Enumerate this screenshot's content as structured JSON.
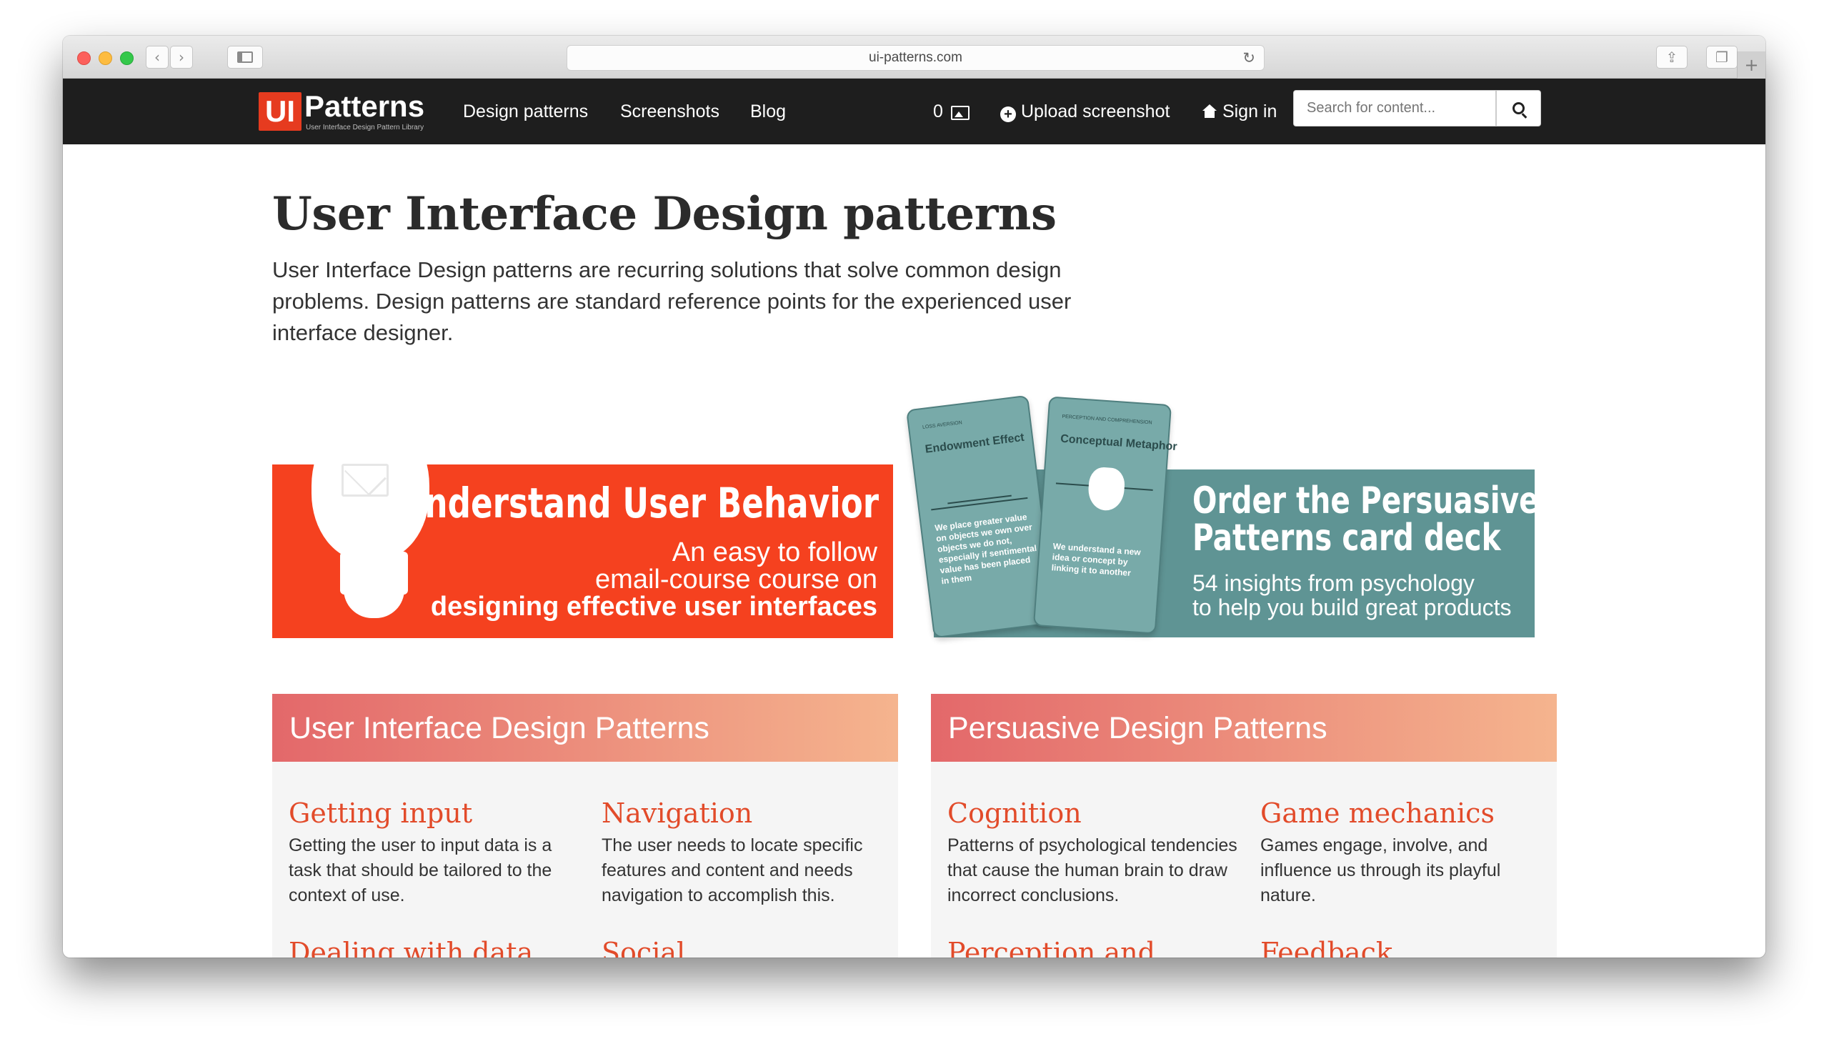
{
  "browser": {
    "url": "ui-patterns.com",
    "back_glyph": "‹",
    "forward_glyph": "›",
    "reload_glyph": "↻",
    "share_glyph": "⇪",
    "tabs_glyph": "❐",
    "new_tab_glyph": "+"
  },
  "nav": {
    "logo_ui": "UI",
    "logo_patterns": "Patterns",
    "logo_tagline": "User Interface Design Pattern Library",
    "links": [
      "Design patterns",
      "Screenshots",
      "Blog"
    ],
    "screenshot_count": "0",
    "upload_label": "Upload screenshot",
    "signin_label": "Sign in",
    "search_placeholder": "Search for content..."
  },
  "hero": {
    "title": "User Interface Design patterns",
    "intro": "User Interface Design patterns are recurring solutions that solve common design problems. Design patterns are standard reference points for the experienced user interface designer."
  },
  "banner_course": {
    "title": "Understand User Behavior",
    "line1": "An easy to follow",
    "line2": "email-course course on",
    "line3": "designing effective user interfaces",
    "color": "#f5411f"
  },
  "banner_cards": {
    "title_line1": "Order the Persuasive",
    "title_line2": "Patterns card deck",
    "sub_line1": "54 insights from psychology",
    "sub_line2": "to help you build great products",
    "color": "#5f9494",
    "card1": {
      "category": "LOSS AVERSION",
      "title": "Endowment Effect",
      "body": "We place greater value on objects we own over objects we do not, especially if sentimental value has been placed in them"
    },
    "card2": {
      "category": "PERCEPTION AND COMPREHENSION",
      "title": "Conceptual Metaphor",
      "body": "We understand a new idea or concept by linking it to another"
    }
  },
  "panels": [
    {
      "heading": "User Interface Design Patterns",
      "items": [
        {
          "title": "Getting input",
          "desc": "Getting the user to input data is a task that should be tailored to the context of use."
        },
        {
          "title": "Navigation",
          "desc": "The user needs to locate specific features and content and needs navigation to accomplish this."
        },
        {
          "title": "Dealing with data"
        },
        {
          "title": "Social"
        }
      ]
    },
    {
      "heading": "Persuasive Design Patterns",
      "items": [
        {
          "title": "Cognition",
          "desc": "Patterns of psychological tendencies that cause the human brain to draw incorrect conclusions."
        },
        {
          "title": "Game mechanics",
          "desc": "Games engage, involve, and influence us through its playful nature."
        },
        {
          "title": "Perception and"
        },
        {
          "title": "Feedback"
        }
      ]
    }
  ],
  "colors": {
    "accent": "#e24b2a",
    "nav_bg": "#1e1e1e"
  }
}
